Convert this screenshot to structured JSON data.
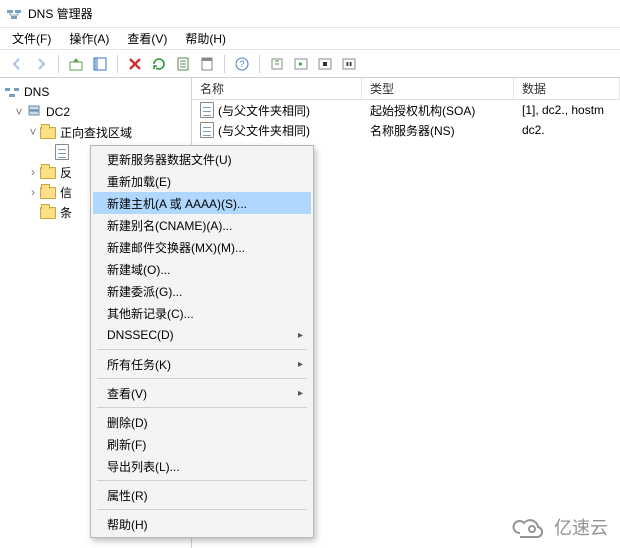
{
  "title": "DNS 管理器",
  "menu": {
    "file": "文件(F)",
    "action": "操作(A)",
    "view": "查看(V)",
    "help": "帮助(H)"
  },
  "tree": {
    "root": "DNS",
    "server": "DC2",
    "forward_zone": "正向查找区域",
    "nodes": {
      "n1": "反",
      "n2": "信",
      "n3": "条"
    }
  },
  "list": {
    "headers": {
      "name": "名称",
      "type": "类型",
      "data": "数据"
    },
    "rows": [
      {
        "name": "(与父文件夹相同)",
        "type": "起始授权机构(SOA)",
        "data": "[1], dc2., hostm"
      },
      {
        "name": "(与父文件夹相同)",
        "type": "名称服务器(NS)",
        "data": "dc2."
      }
    ]
  },
  "context_menu": {
    "update_file": "更新服务器数据文件(U)",
    "reload": "重新加载(E)",
    "new_host": "新建主机(A 或 AAAA)(S)...",
    "new_cname": "新建别名(CNAME)(A)...",
    "new_mx": "新建邮件交换器(MX)(M)...",
    "new_domain": "新建域(O)...",
    "new_delegation": "新建委派(G)...",
    "other_new": "其他新记录(C)...",
    "dnssec": "DNSSEC(D)",
    "all_tasks": "所有任务(K)",
    "view": "查看(V)",
    "delete": "删除(D)",
    "refresh": "刷新(F)",
    "export_list": "导出列表(L)...",
    "properties": "属性(R)",
    "help": "帮助(H)"
  },
  "watermark": "亿速云"
}
